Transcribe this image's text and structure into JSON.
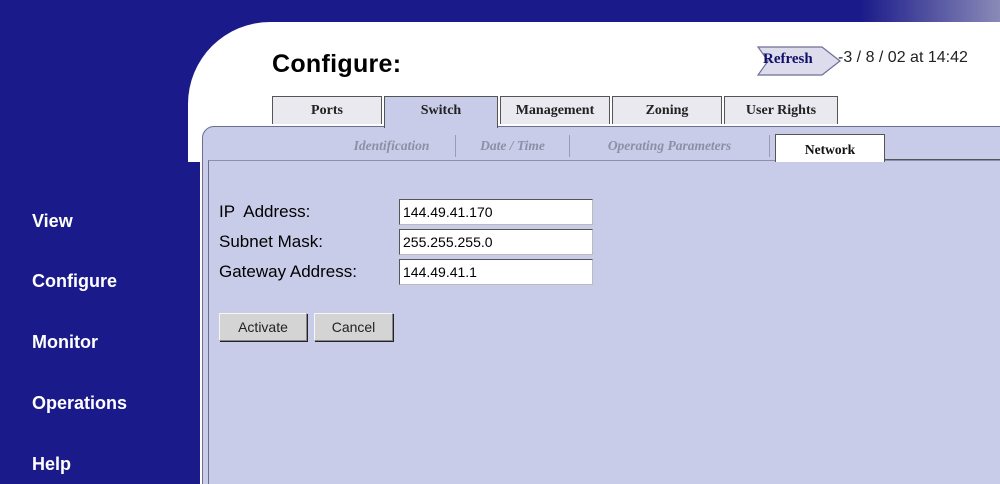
{
  "header": {
    "title": "Configure:",
    "refresh_label": "Refresh",
    "refresh_time": "-3 / 8 / 02 at 14:42"
  },
  "sidebar": {
    "items": [
      {
        "label": "View"
      },
      {
        "label": "Configure"
      },
      {
        "label": "Monitor"
      },
      {
        "label": "Operations"
      },
      {
        "label": "Help"
      }
    ]
  },
  "main_tabs": [
    {
      "label": "Ports",
      "active": false
    },
    {
      "label": "Switch",
      "active": true
    },
    {
      "label": "Management",
      "active": false
    },
    {
      "label": "Zoning",
      "active": false
    },
    {
      "label": "User Rights",
      "active": false
    }
  ],
  "sub_tabs": [
    {
      "label": "Identification",
      "active": false
    },
    {
      "label": "Date / Time",
      "active": false
    },
    {
      "label": "Operating Parameters",
      "active": false
    },
    {
      "label": "Network",
      "active": true
    }
  ],
  "form": {
    "ip_label": "IP  Address:",
    "ip_value": "144.49.41.170",
    "subnet_label": "Subnet Mask:",
    "subnet_value": "255.255.255.0",
    "gateway_label": "Gateway Address:",
    "gateway_value": "144.49.41.1"
  },
  "buttons": {
    "activate": "Activate",
    "cancel": "Cancel"
  },
  "colors": {
    "frame_navy": "#1a1a8a",
    "panel_lavender": "#c9cce8",
    "sidebar_text": "#ffffff"
  }
}
